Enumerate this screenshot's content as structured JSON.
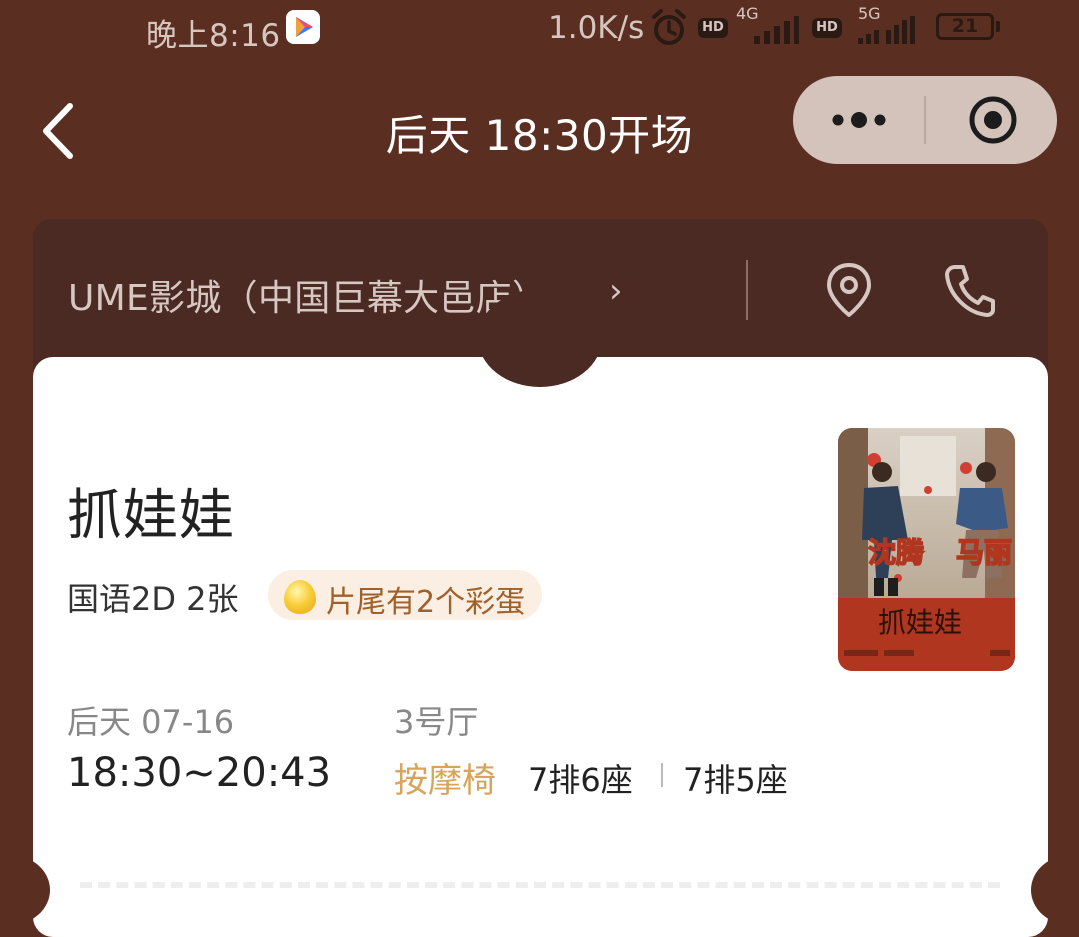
{
  "status_bar": {
    "time": "晚上8:16",
    "net_speed": "1.0K/s",
    "hd_label": "HD",
    "net_type_1": "4G",
    "net_type_2": "5G",
    "battery": "21"
  },
  "header": {
    "title": "后天 18:30开场"
  },
  "cinema": {
    "name": "UME影城（中国巨幕大邑店）",
    "chevron": "›"
  },
  "movie": {
    "title": "抓娃娃",
    "format": "国语2D 2张",
    "easter_egg": "片尾有2个彩蛋",
    "poster": {
      "actor_1": "沈腾",
      "actor_2": "马丽",
      "title": "抓娃娃"
    }
  },
  "showtime": {
    "date": "后天 07-16",
    "time_range": "18:30~20:43",
    "hall": "3号厅",
    "seat_type": "按摩椅",
    "seats": [
      "7排6座",
      "7排5座"
    ]
  },
  "colors": {
    "background": "#5a2f22",
    "cinema_bar": "#4a2a22",
    "accent_gold": "#d7a45a",
    "capsule": "#d4c3bb"
  }
}
